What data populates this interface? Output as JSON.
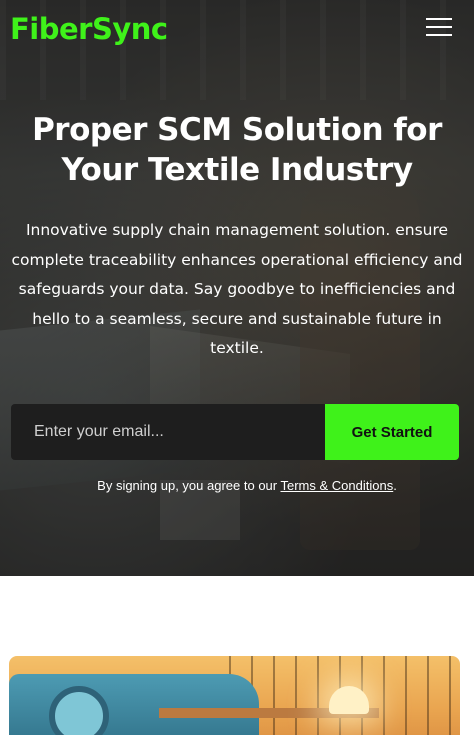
{
  "brand": {
    "logo": "FiberSync",
    "accent_color": "#3ff21a"
  },
  "nav": {
    "menu_icon": "hamburger-menu-icon"
  },
  "hero": {
    "headline": "Proper SCM Solution for Your Textile Industry",
    "subtext": "Innovative supply chain management solution. ensure complete traceability enhances operational efficiency and safeguards your data. Say goodbye to inefficiencies and hello to a seamless, secure and sustainable future in textile.",
    "email_placeholder": "Enter your email...",
    "cta_label": "Get Started",
    "terms_prefix": "By signing up, you agree to our",
    "terms_link": "Terms & Conditions",
    "terms_suffix": "."
  }
}
